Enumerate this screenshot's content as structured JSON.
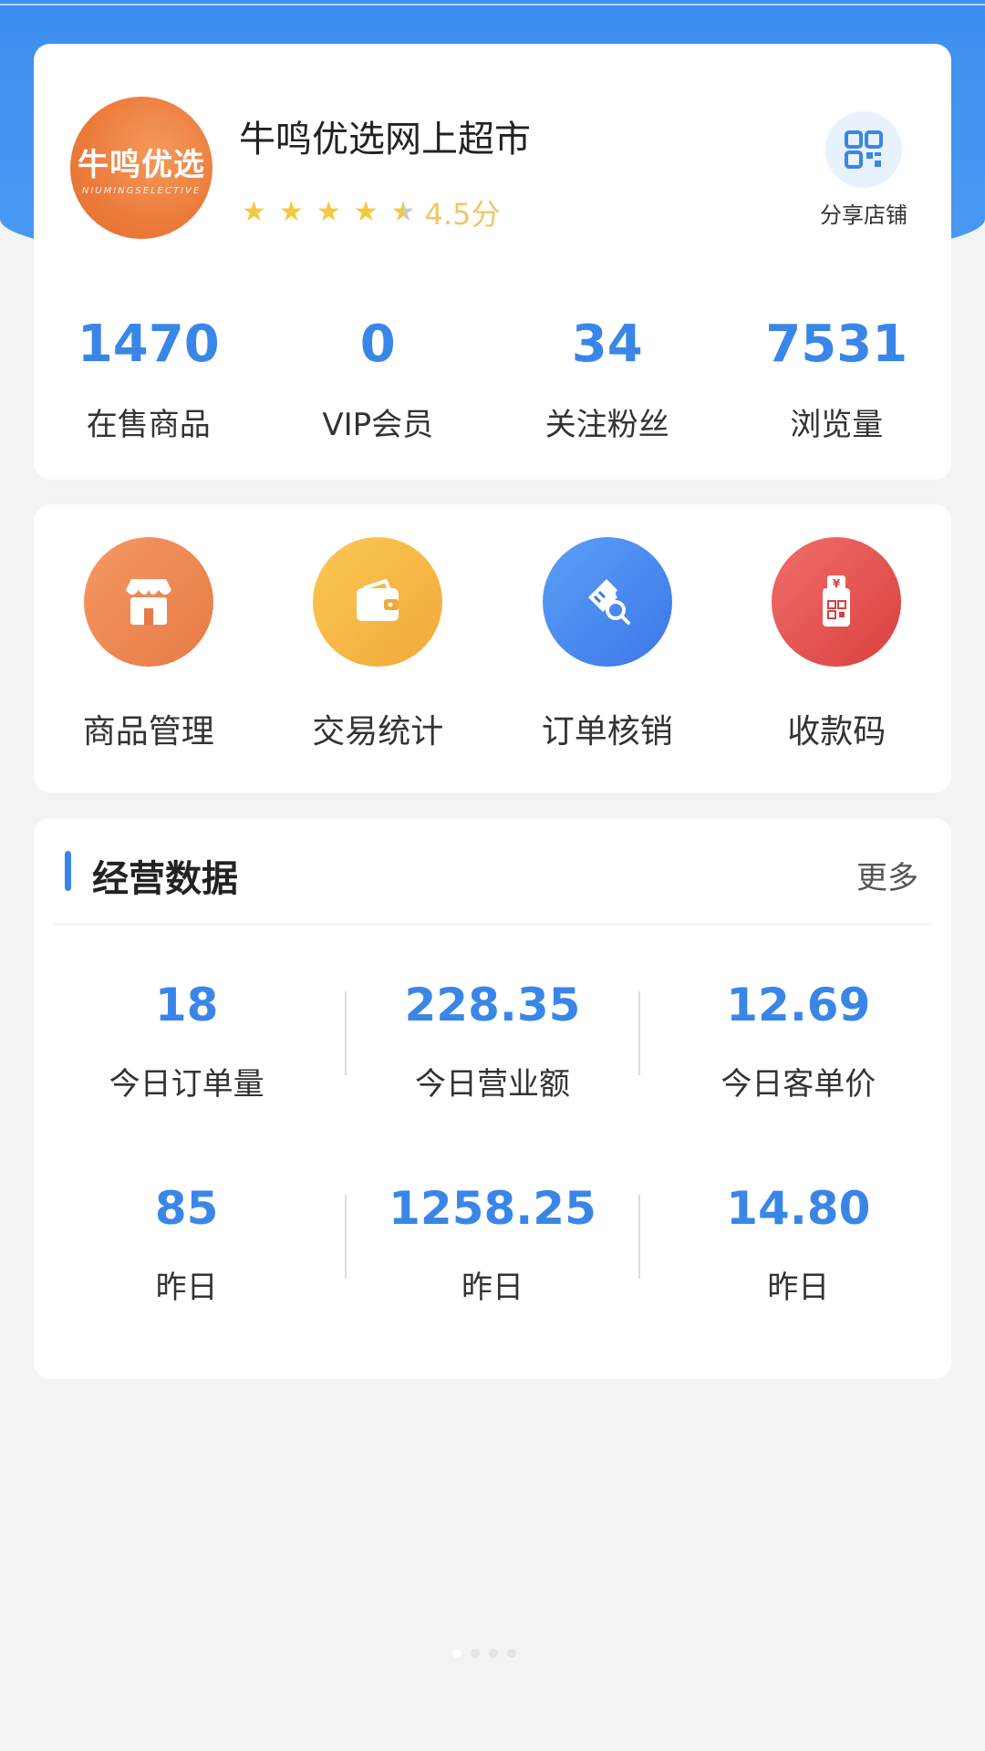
{
  "store": {
    "logo_text": "牛鸣优选",
    "logo_subtext": "NIUMINGSELECTIVE",
    "name": "牛鸣优选网上超市",
    "rating": 4.5,
    "rating_label": "4.5分",
    "share_label": "分享店铺"
  },
  "stats": [
    {
      "value": "1470",
      "label": "在售商品"
    },
    {
      "value": "0",
      "label": "VIP会员"
    },
    {
      "value": "34",
      "label": "关注粉丝"
    },
    {
      "value": "7531",
      "label": "浏览量"
    }
  ],
  "menu": [
    {
      "label": "商品管理",
      "icon": "store-icon",
      "color": "#ed844f"
    },
    {
      "label": "交易统计",
      "icon": "wallet-icon",
      "color": "#f6b843"
    },
    {
      "label": "订单核销",
      "icon": "ticket-search-icon",
      "color": "#4a8cf0"
    },
    {
      "label": "收款码",
      "icon": "payment-qr-icon",
      "color": "#e5514f"
    }
  ],
  "business": {
    "title": "经营数据",
    "more_label": "更多",
    "today": [
      {
        "value": "18",
        "label": "今日订单量"
      },
      {
        "value": "228.35",
        "label": "今日营业额"
      },
      {
        "value": "12.69",
        "label": "今日客单价"
      }
    ],
    "yesterday": [
      {
        "value": "85",
        "label": "昨日"
      },
      {
        "value": "1258.25",
        "label": "昨日"
      },
      {
        "value": "14.80",
        "label": "昨日"
      }
    ]
  },
  "page_indicator": {
    "count": 4,
    "active": 0
  },
  "colors": {
    "accent": "#3a86e8",
    "header_bg": "#4a9af3",
    "star": "#f5c842"
  }
}
